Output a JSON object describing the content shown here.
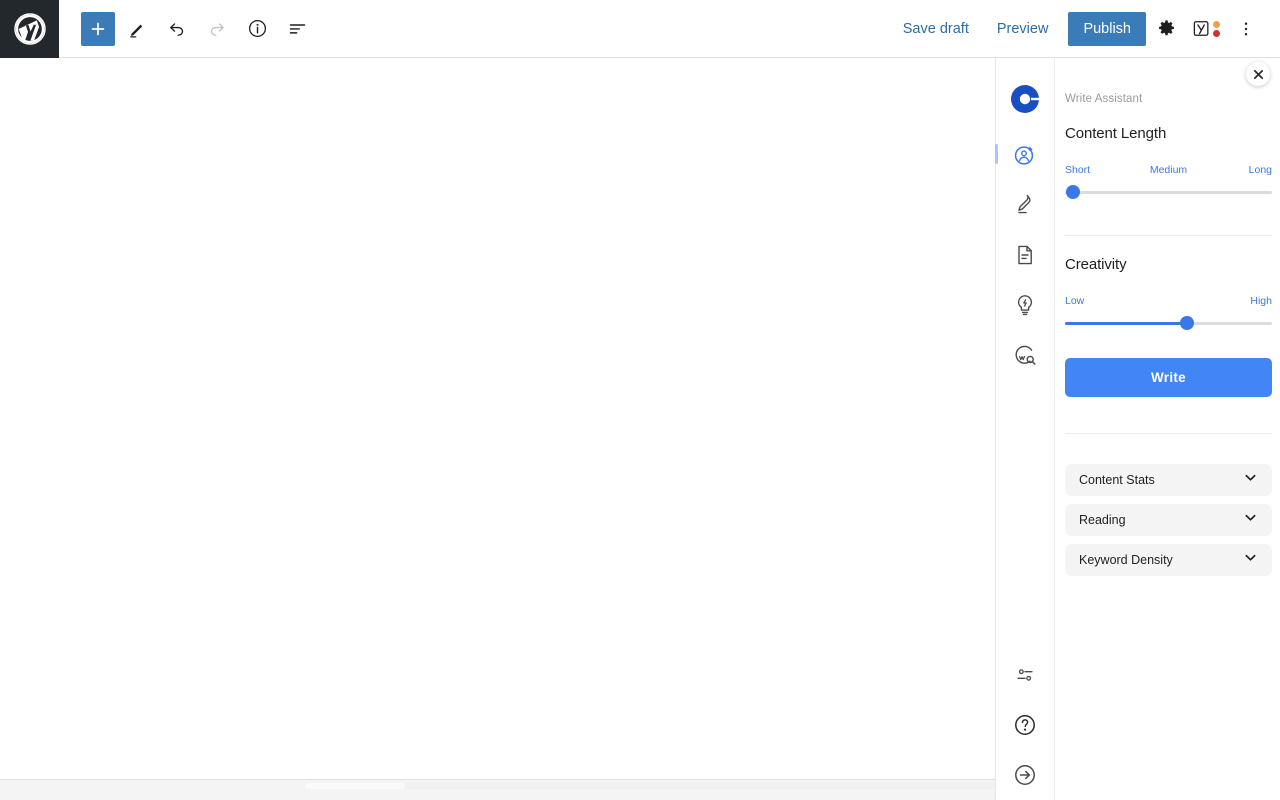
{
  "topbar": {
    "logo_icon": "wordpress-logo-icon",
    "add_block_label": "+",
    "add_block_icon": "plus-icon",
    "tools_icon": "pencil-icon",
    "undo_icon": "undo-icon",
    "redo_icon": "redo-icon",
    "info_icon": "info-icon",
    "list_view_icon": "list-view-icon",
    "save_draft_label": "Save draft",
    "preview_label": "Preview",
    "publish_label": "Publish",
    "settings_icon": "gear-icon",
    "yoast_icon": "yoast-seo-icon",
    "options_icon": "more-vertical-icon",
    "yoast_dot_top_color": "#f19d4a",
    "yoast_dot_bottom_color": "#cc3333",
    "publish_color": "#3a7bb8"
  },
  "rail": {
    "logo_icon": "app-logo-icon",
    "items": [
      {
        "icon": "write-assistant-icon",
        "active": true
      },
      {
        "icon": "pen-edit-icon",
        "active": false
      },
      {
        "icon": "document-icon",
        "active": false
      },
      {
        "icon": "lightbulb-idea-icon",
        "active": false
      },
      {
        "icon": "web-search-icon",
        "active": false
      }
    ],
    "bottom_items": [
      {
        "icon": "settings-sliders-icon"
      },
      {
        "icon": "help-question-icon"
      },
      {
        "icon": "collapse-arrow-icon"
      }
    ]
  },
  "panel": {
    "close_icon": "close-icon",
    "label": "Write Assistant",
    "content_length": {
      "title": "Content Length",
      "labels": {
        "min": "Short",
        "mid": "Medium",
        "max": "Long"
      },
      "value_percent": 4,
      "fill_percent": 0
    },
    "creativity": {
      "title": "Creativity",
      "labels": {
        "min": "Low",
        "max": "High"
      },
      "value_percent": 59,
      "fill_percent": 59
    },
    "write_button_label": "Write",
    "accent_color": "#4285f4",
    "accordions": [
      {
        "label": "Content Stats",
        "icon": "chevron-down-icon"
      },
      {
        "label": "Reading",
        "icon": "chevron-down-icon"
      },
      {
        "label": "Keyword Density",
        "icon": "chevron-down-icon"
      }
    ]
  }
}
